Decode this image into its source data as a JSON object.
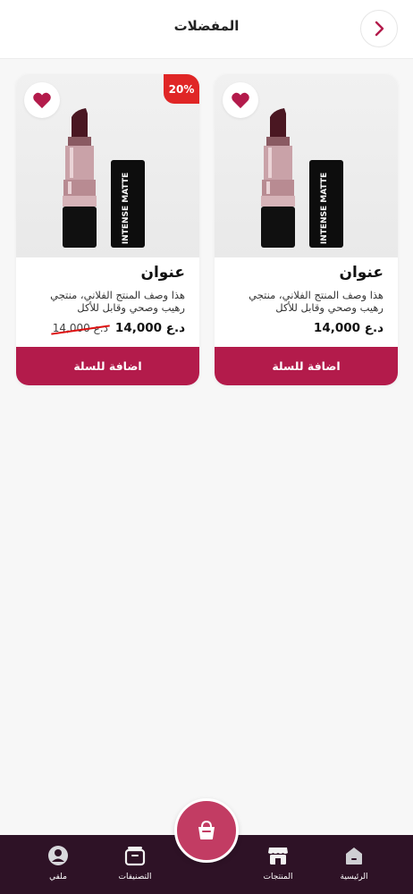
{
  "header": {
    "title": "المفضلات",
    "back_icon": "chevron-right-icon"
  },
  "colors": {
    "accent": "#b31b4b",
    "discount": "#e02626",
    "nav_bg": "#2e1226",
    "fab": "#c23c63"
  },
  "products": [
    {
      "title": "عنوان",
      "description": "هذا وصف المنتج الفلاني، منتجي رهيب وصحي وقابل للأكل",
      "price": "14,000 د.ع",
      "old_price": "",
      "discount": "",
      "add_to_cart": "اضافة للسلة",
      "favorite": true,
      "image_label": "INTENSE MATTE"
    },
    {
      "title": "عنوان",
      "description": "هذا وصف المنتج الفلاني، منتجي رهيب وصحي وقابل للأكل",
      "price": "14,000 د.ع",
      "old_price": "14,000 د.ع",
      "discount": "20%",
      "add_to_cart": "اضافة للسلة",
      "favorite": true,
      "image_label": "INTENSE MATTE"
    }
  ],
  "nav": {
    "home": "الرئيسية",
    "products": "المنتجات",
    "categories": "التصنيفات",
    "profile": "ملفي",
    "center_icon": "basket-icon"
  }
}
